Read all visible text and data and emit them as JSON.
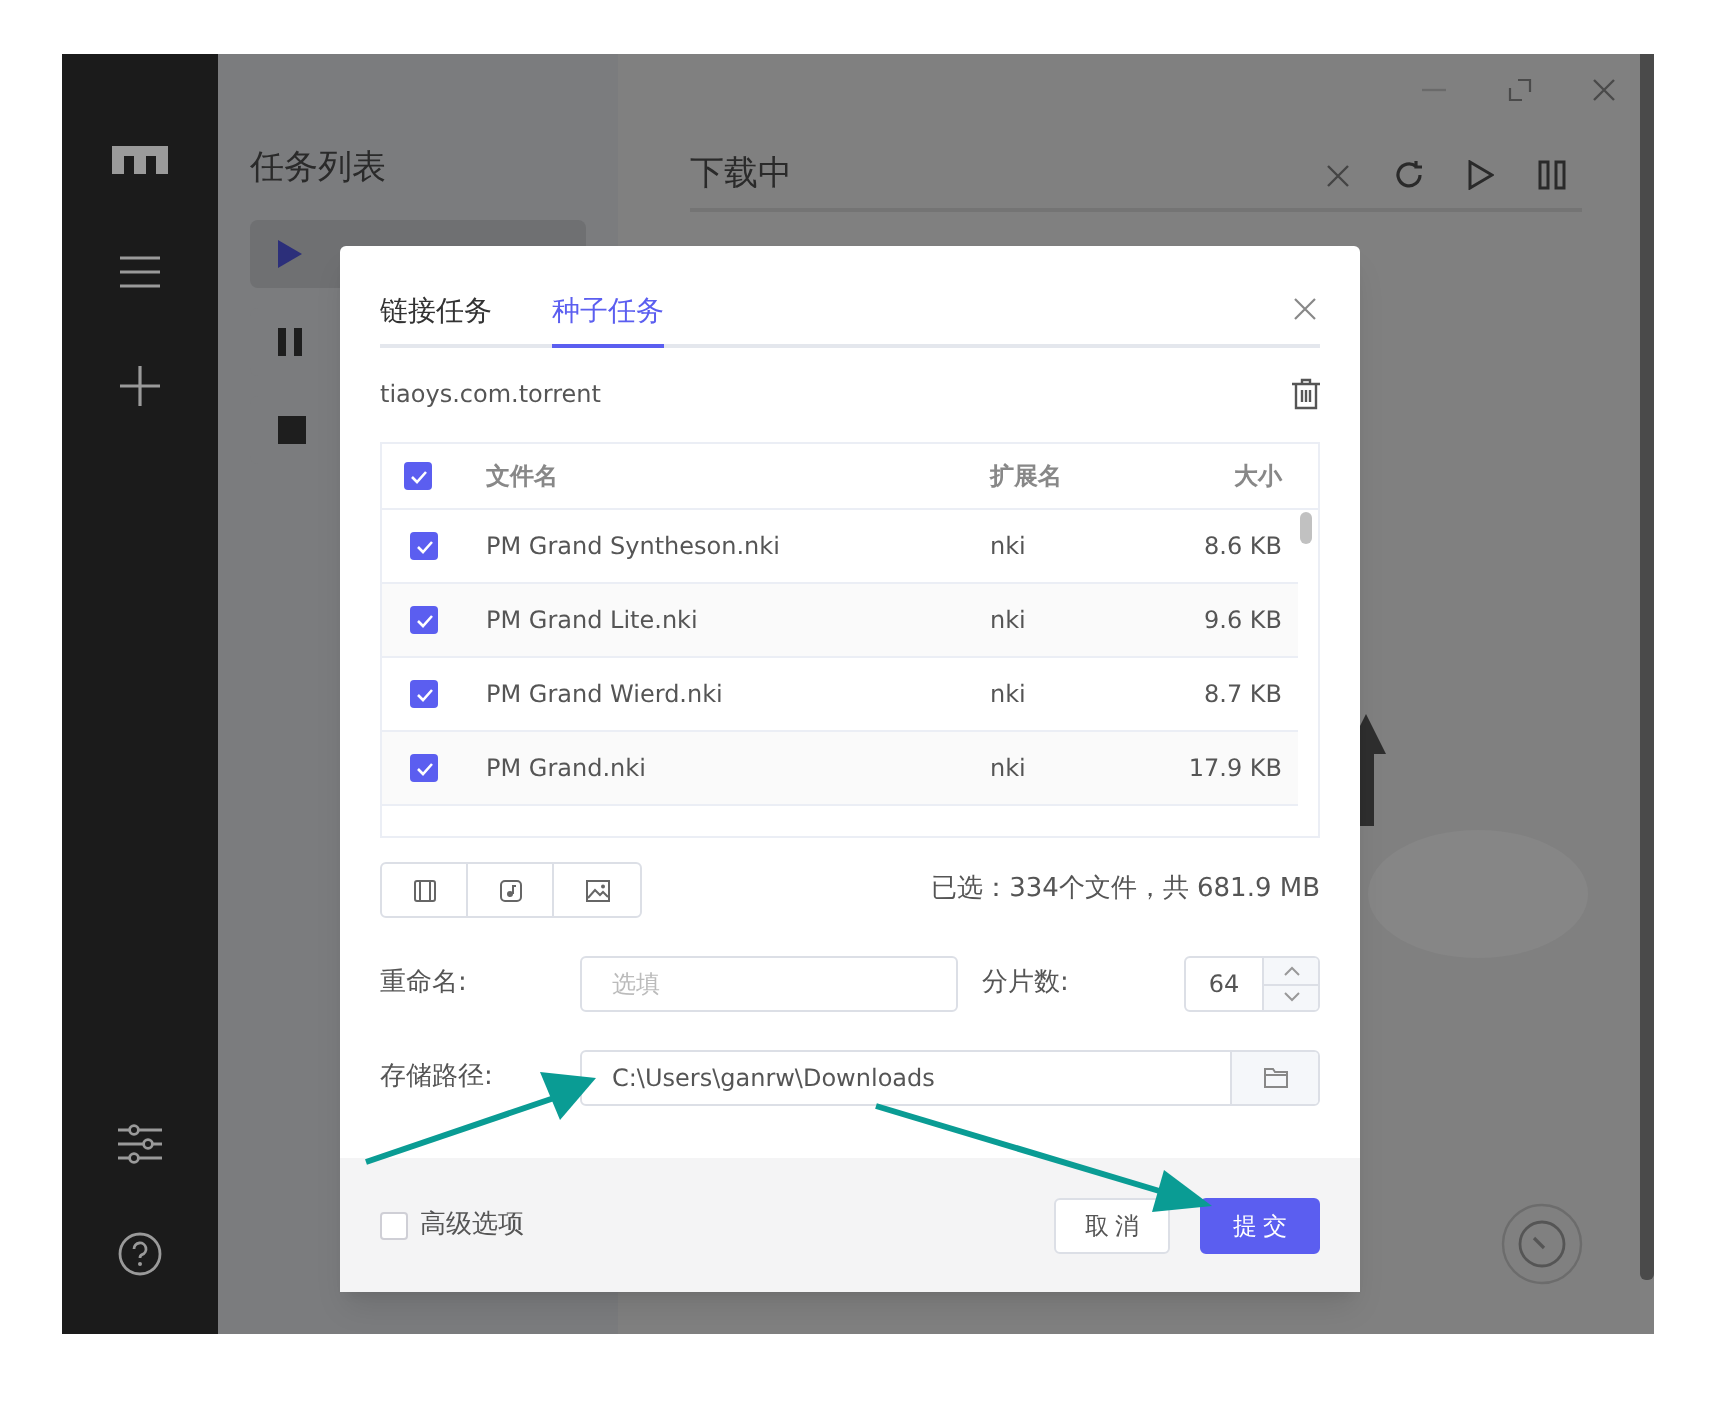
{
  "task_panel": {
    "title": "任务列表",
    "items": [
      {
        "kind": "play",
        "selected": true
      },
      {
        "kind": "pause",
        "selected": false
      },
      {
        "kind": "stop",
        "selected": false
      }
    ]
  },
  "main": {
    "title": "下载中"
  },
  "dialog": {
    "tabs": [
      {
        "label": "链接任务",
        "selected": false
      },
      {
        "label": "种子任务",
        "selected": true
      }
    ],
    "torrent_file": "tiaoys.com.torrent",
    "table": {
      "columns": [
        "文件名",
        "扩展名",
        "大小"
      ],
      "all_checked": true,
      "rows": [
        {
          "name": "PM Grand Syntheson.nki",
          "ext": "nki",
          "size": "8.6 KB",
          "checked": true
        },
        {
          "name": "PM Grand Lite.nki",
          "ext": "nki",
          "size": "9.6 KB",
          "checked": true
        },
        {
          "name": "PM Grand Wierd.nki",
          "ext": "nki",
          "size": "8.7 KB",
          "checked": true
        },
        {
          "name": "PM Grand.nki",
          "ext": "nki",
          "size": "17.9 KB",
          "checked": true
        }
      ]
    },
    "summary": "已选：334个文件，共 681.9 MB",
    "rename": {
      "label": "重命名:",
      "placeholder": "选填"
    },
    "segments": {
      "label": "分片数:",
      "value": "64"
    },
    "save_path": {
      "label": "存储路径:",
      "value": "C:\\Users\\ganrw\\Downloads"
    },
    "advanced": {
      "label": "高级选项",
      "checked": false
    },
    "buttons": [
      {
        "label": "取消",
        "kind": "secondary"
      },
      {
        "label": "提交",
        "kind": "primary"
      }
    ]
  }
}
